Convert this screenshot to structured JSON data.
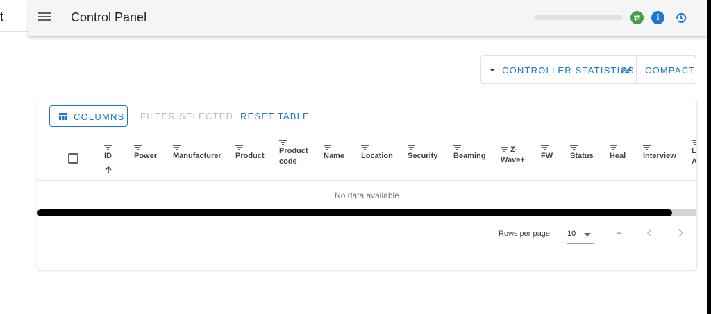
{
  "drawer": {
    "partial_text": "t"
  },
  "appbar": {
    "title": "Control Panel"
  },
  "icons": {
    "menu": "menu-icon",
    "sync": "sync-icon",
    "info": "info-icon",
    "history": "history-icon",
    "trend": "trend-icon",
    "columns": "view-column-icon",
    "filter": "filter-icon",
    "sort_up": "arrow-up-icon",
    "prev": "chevron-left-icon",
    "next": "chevron-right-icon"
  },
  "colors": {
    "accent": "#1976d2",
    "sync_status": "#43a047",
    "disabled": "#bdbdbd"
  },
  "toolbar": {
    "controller_statistics_label": "CONTROLLER STATISTICS",
    "compact_label": "COMPACT"
  },
  "table": {
    "columns_button": "COLUMNS",
    "filter_selected_button": "FILTER SELECTED",
    "reset_table_button": "RESET TABLE",
    "headers": {
      "id": "ID",
      "power": "Power",
      "manufacturer": "Manufacturer",
      "product": "Product",
      "product_code_1": "Product",
      "product_code_2": "code",
      "name": "Name",
      "location": "Location",
      "security": "Security",
      "beaming": "Beaming",
      "zwave_1": "Z-",
      "zwave_2": "Wave+",
      "fw": "FW",
      "status": "Status",
      "heal": "Heal",
      "interview": "Interview",
      "last_1": "L",
      "last_2": "A"
    },
    "sort": {
      "column": "ID",
      "direction": "ascending"
    },
    "empty_text": "No data available"
  },
  "pagination": {
    "rows_per_page_label": "Rows per page:",
    "rows_per_page_value": "10",
    "range": "–"
  }
}
